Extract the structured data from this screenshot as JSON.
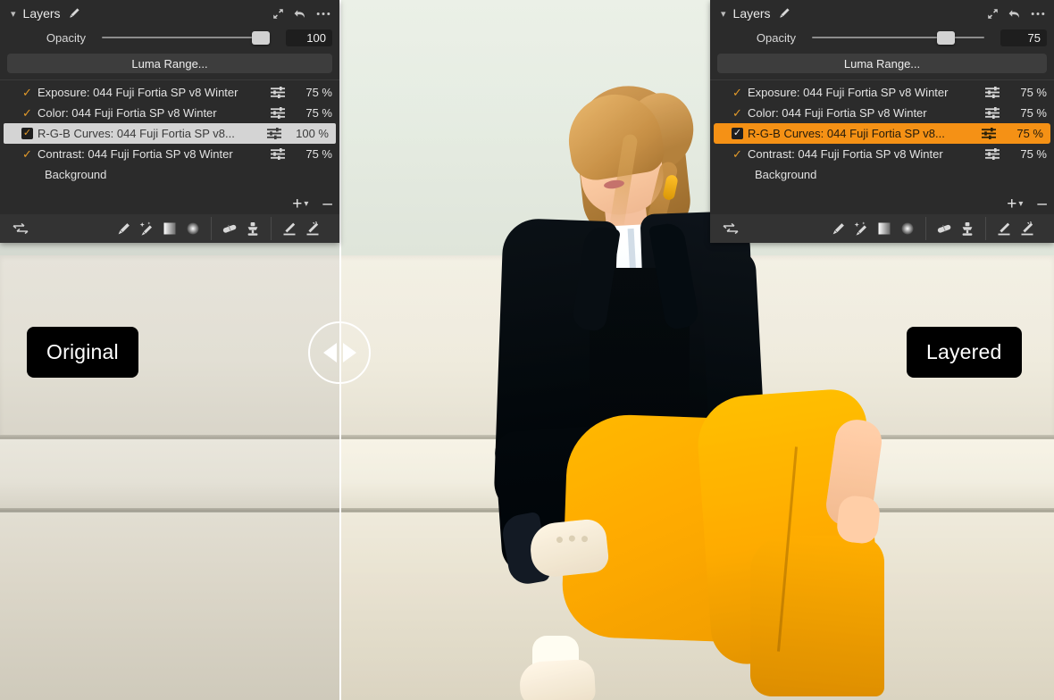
{
  "app": {
    "comparison": {
      "left_badge": "Original",
      "right_badge": "Layered",
      "handle_icon_left": "triangle-left-icon",
      "handle_icon_right": "triangle-right-icon"
    },
    "colors": {
      "panel_bg": "#2b2b2b",
      "toolbar_bg": "#333333",
      "accent_orange": "#f59115",
      "check_orange": "#e39a2a",
      "selected_light": "#d4d4d4",
      "badge_bg": "#000000",
      "divider": "#ffffff"
    }
  },
  "panels": [
    {
      "id": "left",
      "title": "Layers",
      "collapse_icon": "chevron-down-icon",
      "brush_icon": "brush-icon",
      "header_icons": [
        "expand-arrows-icon",
        "reset-arrow-icon",
        "more-options-icon"
      ],
      "opacity": {
        "label": "Opacity",
        "value": "100",
        "slider_percent": 100
      },
      "luma_button": "Luma Range...",
      "layers": [
        {
          "name": "Exposure: 044 Fuji Fortia SP v8 Winter",
          "percent": "75 %",
          "checked": true,
          "selected": false,
          "adjust_icon": "sliders-icon"
        },
        {
          "name": "Color: 044 Fuji Fortia SP v8 Winter",
          "percent": "75 %",
          "checked": true,
          "selected": false,
          "adjust_icon": "sliders-icon"
        },
        {
          "name": "R-G-B Curves: 044 Fuji Fortia SP v8...",
          "percent": "100 %",
          "checked": true,
          "selected": true,
          "adjust_icon": "sliders-icon"
        },
        {
          "name": "Contrast: 044 Fuji Fortia SP v8 Winter",
          "percent": "75 %",
          "checked": true,
          "selected": false,
          "adjust_icon": "sliders-icon"
        }
      ],
      "background_layer": "Background",
      "add_button": "+",
      "add_chevron": "chevron-down-icon",
      "remove_button": "–",
      "toolbar_icons": [
        "layer-options-icon",
        "brush-icon",
        "magic-brush-icon",
        "linear-gradient-mask-icon",
        "radial-gradient-mask-icon",
        "eraser-icon",
        "clone-stamp-icon",
        "draw-mask-icon",
        "erase-mask-icon"
      ]
    },
    {
      "id": "right",
      "title": "Layers",
      "collapse_icon": "chevron-down-icon",
      "brush_icon": "brush-icon",
      "header_icons": [
        "expand-arrows-icon",
        "reset-arrow-icon",
        "more-options-icon"
      ],
      "opacity": {
        "label": "Opacity",
        "value": "75",
        "slider_percent": 72
      },
      "luma_button": "Luma Range...",
      "layers": [
        {
          "name": "Exposure: 044 Fuji Fortia SP v8 Winter",
          "percent": "75 %",
          "checked": true,
          "selected": false,
          "adjust_icon": "sliders-icon"
        },
        {
          "name": "Color: 044 Fuji Fortia SP v8 Winter",
          "percent": "75 %",
          "checked": true,
          "selected": false,
          "adjust_icon": "sliders-icon"
        },
        {
          "name": "R-G-B Curves: 044 Fuji Fortia SP v8...",
          "percent": "75 %",
          "checked": true,
          "selected": true,
          "adjust_icon": "sliders-icon"
        },
        {
          "name": "Contrast: 044 Fuji Fortia SP v8 Winter",
          "percent": "75 %",
          "checked": true,
          "selected": false,
          "adjust_icon": "sliders-icon"
        }
      ],
      "background_layer": "Background",
      "add_button": "+",
      "add_chevron": "chevron-down-icon",
      "remove_button": "–",
      "toolbar_icons": [
        "layer-options-icon",
        "brush-icon",
        "magic-brush-icon",
        "linear-gradient-mask-icon",
        "radial-gradient-mask-icon",
        "eraser-icon",
        "clone-stamp-icon",
        "draw-mask-icon",
        "erase-mask-icon"
      ]
    }
  ]
}
